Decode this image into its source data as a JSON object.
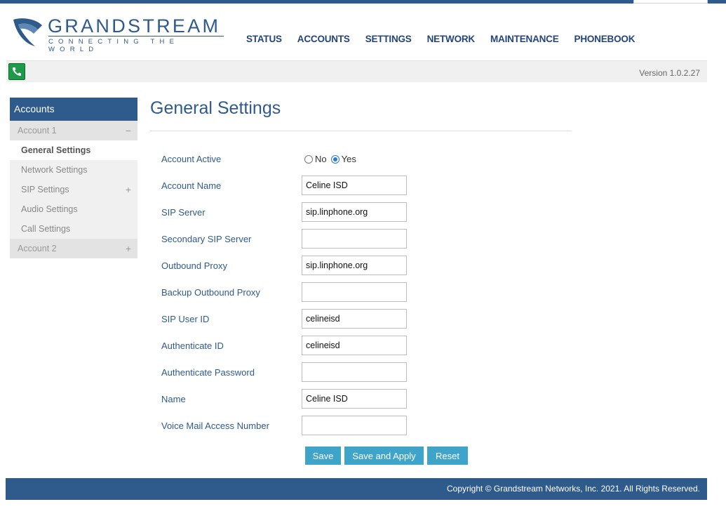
{
  "brand": {
    "name": "GRANDSTREAM",
    "tagline": "CONNECTING THE WORLD",
    "color": "#2f5a8c"
  },
  "nav": {
    "items": [
      {
        "label": "STATUS"
      },
      {
        "label": "ACCOUNTS"
      },
      {
        "label": "SETTINGS"
      },
      {
        "label": "NETWORK"
      },
      {
        "label": "MAINTENANCE"
      },
      {
        "label": "PHONEBOOK"
      }
    ]
  },
  "status_bar": {
    "icon": "phone-icon",
    "version": "Version 1.0.2.27"
  },
  "sidebar": {
    "header": "Accounts",
    "account1": {
      "label": "Account 1",
      "sign": "−"
    },
    "items": [
      {
        "label": "General Settings"
      },
      {
        "label": "Network Settings"
      },
      {
        "label": "SIP Settings",
        "sign": "+"
      },
      {
        "label": "Audio Settings"
      },
      {
        "label": "Call Settings"
      }
    ],
    "account2": {
      "label": "Account 2",
      "sign": "+"
    }
  },
  "main": {
    "title": "General Settings",
    "account_active": {
      "label": "Account Active",
      "options": [
        "No",
        "Yes"
      ],
      "selected": "Yes"
    },
    "fields": [
      {
        "label": "Account Name",
        "value": "Celine ISD"
      },
      {
        "label": "SIP Server",
        "value": "sip.linphone.org"
      },
      {
        "label": "Secondary SIP Server",
        "value": ""
      },
      {
        "label": "Outbound Proxy",
        "value": "sip.linphone.org"
      },
      {
        "label": "Backup Outbound Proxy",
        "value": ""
      },
      {
        "label": "SIP User ID",
        "value": "celineisd"
      },
      {
        "label": "Authenticate ID",
        "value": "celineisd"
      },
      {
        "label": "Authenticate Password",
        "value": ""
      },
      {
        "label": "Name",
        "value": "Celine ISD"
      },
      {
        "label": "Voice Mail Access Number",
        "value": ""
      }
    ],
    "buttons": {
      "save": "Save",
      "save_apply": "Save and Apply",
      "reset": "Reset"
    }
  },
  "footer": {
    "copyright": "Copyright © Grandstream Networks, Inc. 2021. All Rights Reserved."
  },
  "colors": {
    "primary": "#2f5a8c",
    "button": "#3fa4c9",
    "status_green": "#1e9a4a"
  }
}
